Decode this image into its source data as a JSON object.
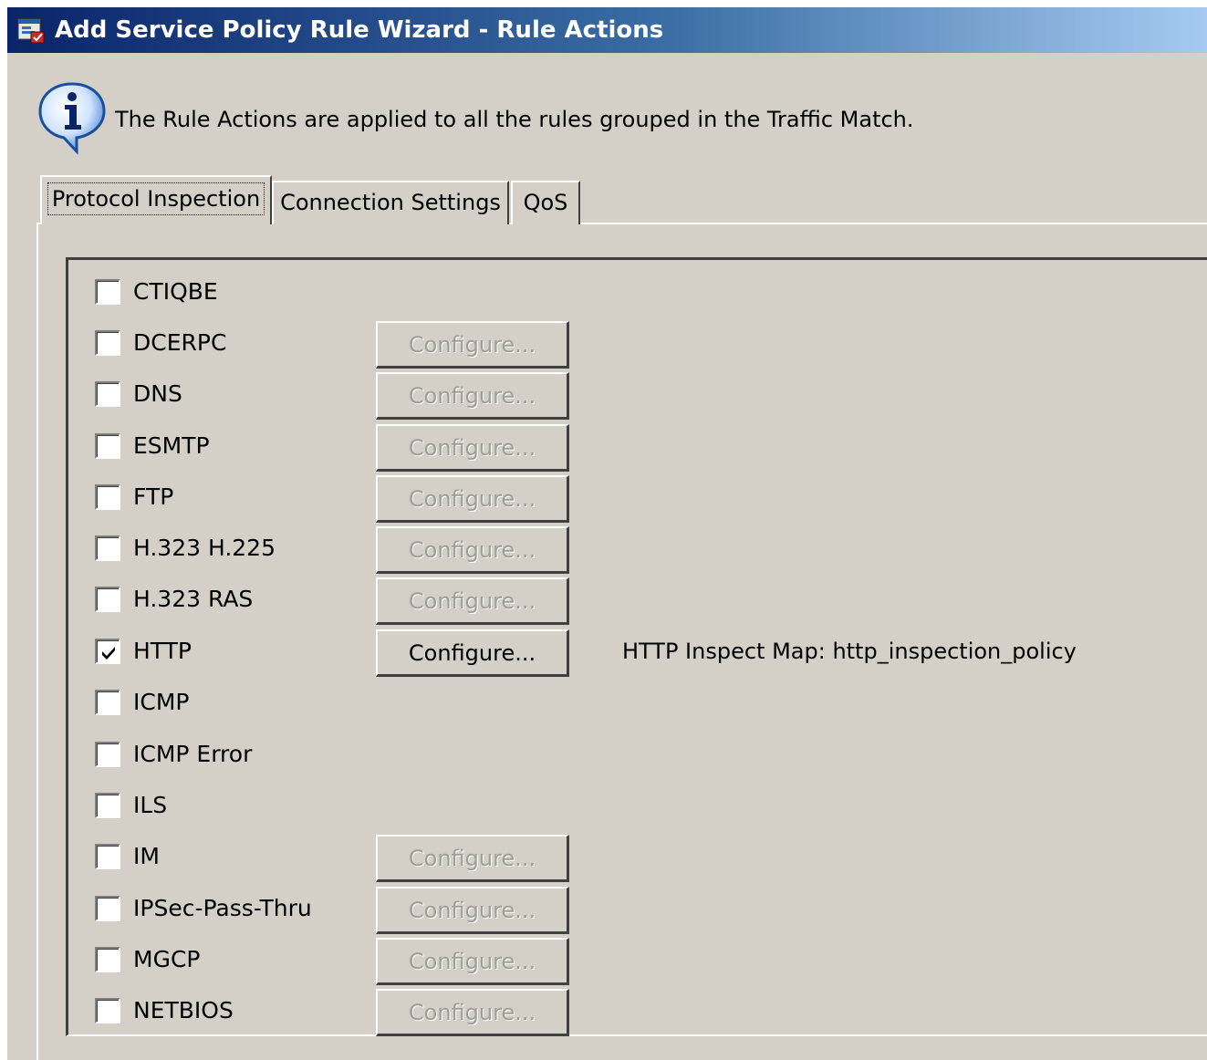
{
  "window": {
    "title": "Add Service Policy Rule Wizard - Rule Actions"
  },
  "info": {
    "text": "The Rule Actions are applied to all the rules grouped in the Traffic Match."
  },
  "tabs": [
    {
      "label": "Protocol Inspection",
      "active": true
    },
    {
      "label": "Connection Settings",
      "active": false
    },
    {
      "label": "QoS",
      "active": false
    }
  ],
  "protocols": [
    {
      "label": "CTIQBE",
      "checked": false,
      "configure": null
    },
    {
      "label": "DCERPC",
      "checked": false,
      "configure": "Configure..."
    },
    {
      "label": "DNS",
      "checked": false,
      "configure": "Configure..."
    },
    {
      "label": "ESMTP",
      "checked": false,
      "configure": "Configure..."
    },
    {
      "label": "FTP",
      "checked": false,
      "configure": "Configure..."
    },
    {
      "label": "H.323 H.225",
      "checked": false,
      "configure": "Configure..."
    },
    {
      "label": "H.323 RAS",
      "checked": false,
      "configure": "Configure..."
    },
    {
      "label": "HTTP",
      "checked": true,
      "configure": "Configure...",
      "map": "HTTP Inspect Map: http_inspection_policy"
    },
    {
      "label": "ICMP",
      "checked": false,
      "configure": null
    },
    {
      "label": "ICMP Error",
      "checked": false,
      "configure": null
    },
    {
      "label": "ILS",
      "checked": false,
      "configure": null
    },
    {
      "label": "IM",
      "checked": false,
      "configure": "Configure..."
    },
    {
      "label": "IPSec-Pass-Thru",
      "checked": false,
      "configure": "Configure..."
    },
    {
      "label": "MGCP",
      "checked": false,
      "configure": "Configure..."
    },
    {
      "label": "NETBIOS",
      "checked": false,
      "configure": "Configure..."
    }
  ],
  "icons": {
    "app": "service-policy-app-icon",
    "info": "info-icon",
    "check": "checkmark-icon"
  },
  "colors": {
    "title_gradient_start": "#0a246a",
    "title_gradient_end": "#a6caf0",
    "face": "#d4d0c8",
    "disabled_text": "#a09c94"
  }
}
